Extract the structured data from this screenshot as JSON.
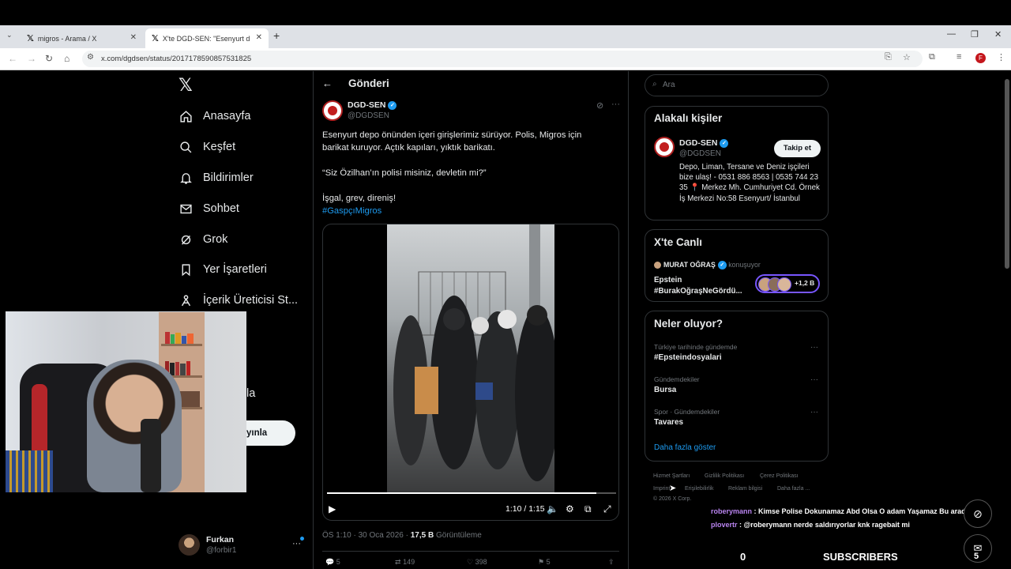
{
  "browser": {
    "tabs": [
      {
        "title": "migros - Arama / X",
        "active": false
      },
      {
        "title": "X'te DGD-SEN: \"Esenyurt depo",
        "active": true
      }
    ],
    "url": "x.com/dgdsen/status/2017178590857531825"
  },
  "nav": {
    "items": [
      {
        "label": "Anasayfa",
        "icon": "home-icon"
      },
      {
        "label": "Keşfet",
        "icon": "search-icon"
      },
      {
        "label": "Bildirimler",
        "icon": "bell-icon"
      },
      {
        "label": "Sohbet",
        "icon": "mail-icon"
      },
      {
        "label": "Grok",
        "icon": "grok-icon"
      },
      {
        "label": "Yer İşaretleri",
        "icon": "bookmark-icon"
      },
      {
        "label": "İçerik Üreticisi St...",
        "icon": "creator-studio-icon"
      }
    ],
    "partial_item": "la",
    "publish_label": "yınla"
  },
  "account": {
    "name": "Furkan",
    "handle": "@forbir1"
  },
  "post": {
    "header": "Gönderi",
    "author": {
      "name": "DGD-SEN",
      "handle": "@DGDSEN"
    },
    "text_lines": [
      "Esenyurt depo önünden içeri girişlerimiz sürüyor. Polis, Migros için",
      "barikat kuruyor. Açtık kapıları, yıktık barikatı.",
      "“Siz Özilhan’ın polisi misiniz, devletin mi?”",
      "İşgal, grev, direniş!"
    ],
    "hashtag": "#GaspçıMigros",
    "video": {
      "time": "1:10 / 1:15",
      "progress": 0.933
    },
    "meta": {
      "time": "ÖS 1:10 · 30 Oca 2026 · ",
      "views": "17,5 B",
      "views_label": " Görüntüleme"
    },
    "actions": {
      "replies": "5",
      "reposts": "149",
      "likes": "398",
      "bookmarks": "5"
    }
  },
  "sidebar": {
    "search_placeholder": "Ara",
    "related": {
      "title": "Alakalı kişiler",
      "name": "DGD-SEN",
      "handle": "@DGDSEN",
      "follow_label": "Takip et",
      "bio": "Depo, Liman, Tersane ve Deniz işçileri bize ulaş! - 0531 886 8563 | 0535 744 23 35 📍 Merkez Mh. Cumhuriyet Cd. Örnek İş Merkezi No:58 Esenyurt/ İstanbul"
    },
    "live": {
      "title": "X'te Canlı",
      "host": "MURAT OĞRAŞ",
      "host_status": "konuşuyor",
      "topic_line1": "Epstein",
      "topic_line2": "#BurakOğraşNeGördü...",
      "listeners": "+1,2 B"
    },
    "trends": {
      "title": "Neler oluyor?",
      "items": [
        {
          "category": "Türkiye tarihinde gündemde",
          "name": "#Epsteindosyalari"
        },
        {
          "category": "Gündemdekiler",
          "name": "Bursa"
        },
        {
          "category": "Spor · Gündemdekiler",
          "name": "Tavares"
        }
      ],
      "show_more": "Daha fazla göster"
    },
    "footer": {
      "links_row1": [
        "Hizmet Şartları",
        "Gizlilik Politikası",
        "Çerez Politikası"
      ],
      "links_row2": [
        "Imprint",
        "Erişilebilirlik",
        "Reklam bilgisi",
        "Daha fazla ..."
      ],
      "copyright": "© 2026 X Corp."
    }
  },
  "overlay": {
    "chat": [
      {
        "user": "roberymann",
        "message": " : Kimse Polise Dokunamaz Abd Olsa O adam Yaşamaz Bu arada"
      },
      {
        "user": "plovertr",
        "message": " : @roberymann nerde saldırıyorlar knk ragebait mi"
      }
    ],
    "subscribers_count": "0",
    "subscribers_label": "SUBSCRIBERS",
    "messages_count": "5"
  }
}
